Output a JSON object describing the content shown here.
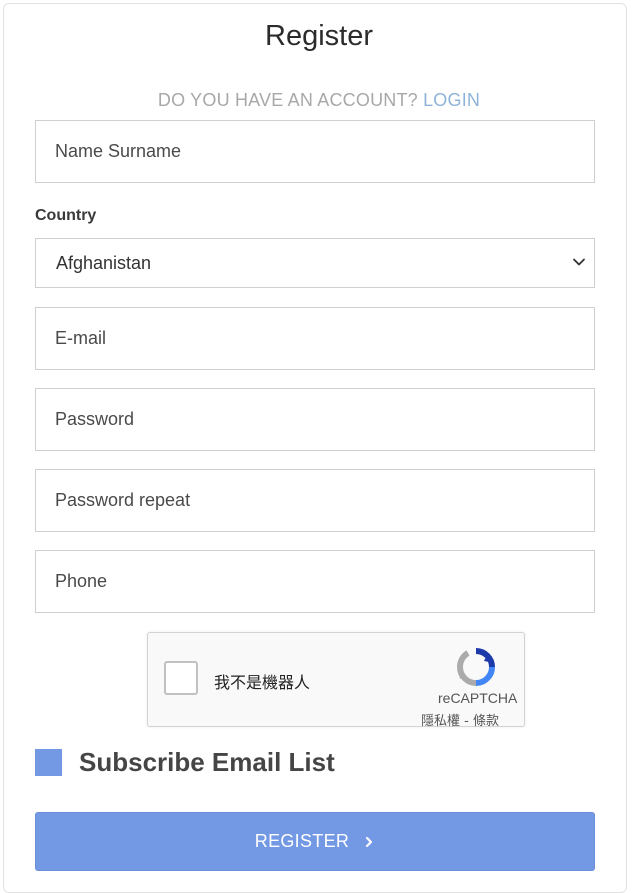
{
  "form": {
    "title": "Register",
    "account_question": "DO YOU HAVE AN ACCOUNT?",
    "login_link": "LOGIN",
    "name_placeholder": "Name Surname",
    "country_label": "Country",
    "country_value": "Afghanistan",
    "email_placeholder": "E-mail",
    "password_placeholder": "Password",
    "password_repeat_placeholder": "Password repeat",
    "phone_placeholder": "Phone",
    "subscribe_label": "Subscribe Email List",
    "register_label": "REGISTER"
  },
  "recaptcha": {
    "label": "我不是機器人",
    "brand": "reCAPTCHA",
    "terms": "隱私權 - 條款"
  },
  "colors": {
    "accent": "#7398e4",
    "login_link": "#8fb4d9",
    "muted_text": "#a8a8a8"
  }
}
